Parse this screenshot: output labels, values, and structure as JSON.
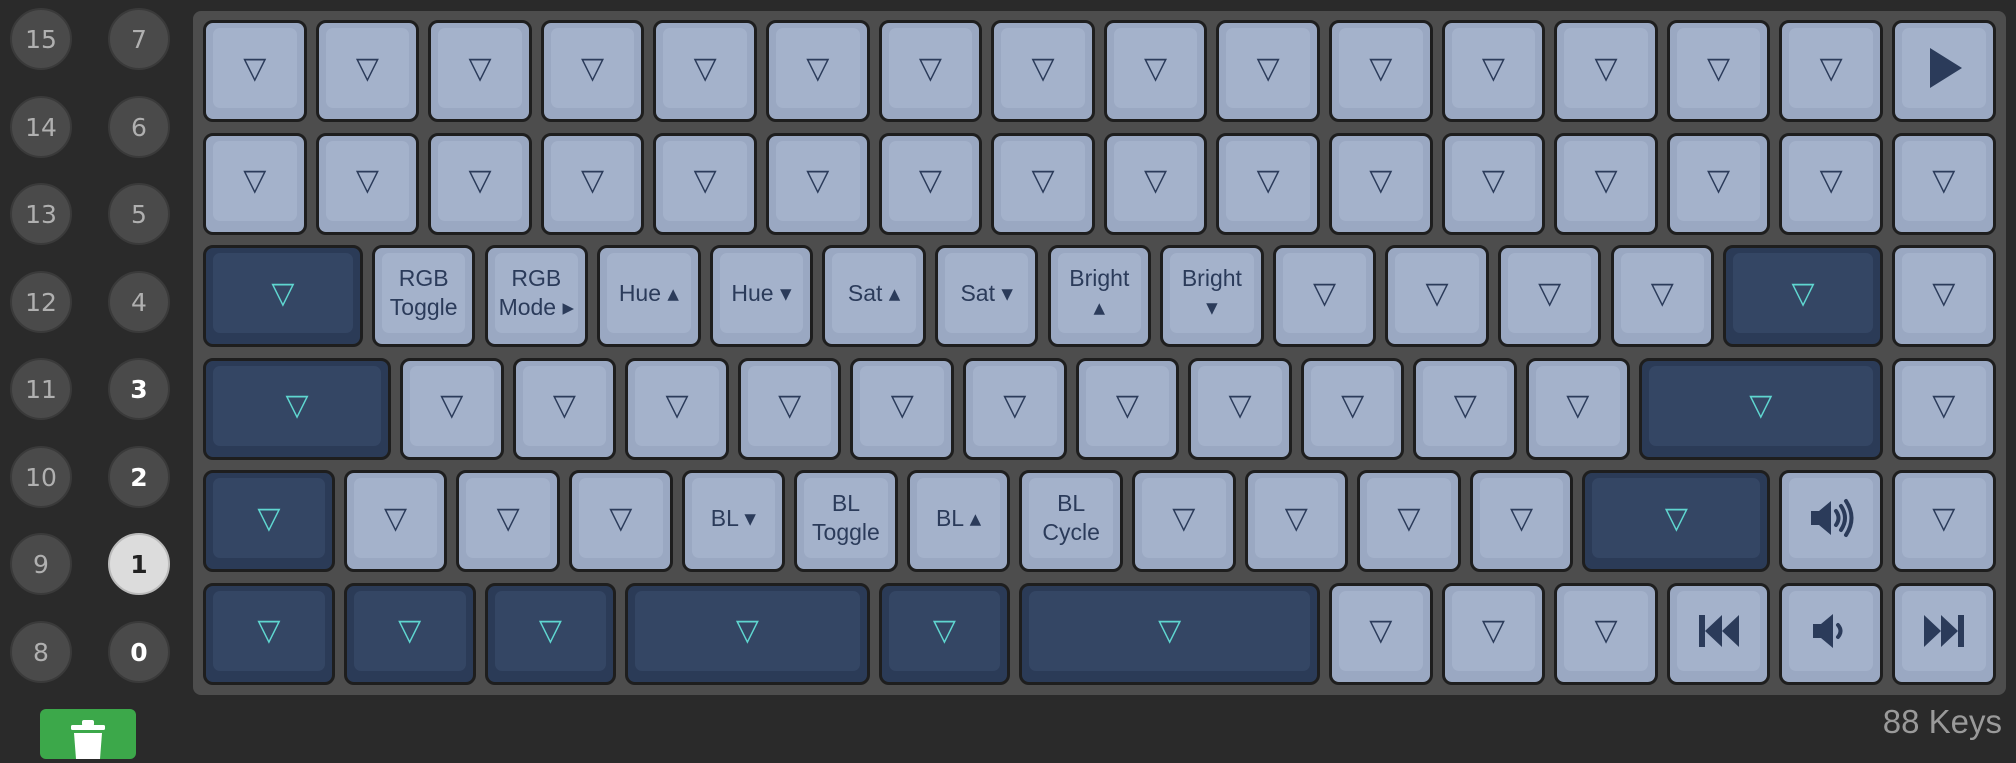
{
  "layers": {
    "left_column": [
      "15",
      "14",
      "13",
      "12",
      "11",
      "10",
      "9",
      "8"
    ],
    "right_column": [
      "7",
      "6",
      "5",
      "4",
      "3",
      "2",
      "1",
      "0"
    ],
    "used": [
      "3",
      "2",
      "1",
      "0"
    ],
    "active": "1"
  },
  "key_symbols": {
    "transparent": "▽",
    "play": "play-icon",
    "volume_up": "volume-up-icon",
    "volume_down": "volume-down-icon",
    "prev_track": "previous-track-icon",
    "next_track": "next-track-icon"
  },
  "keys": {
    "rgb_toggle": "RGB\nToggle",
    "rgb_mode": "RGB\nMode ▸",
    "hue_up": "Hue ▴",
    "hue_down": "Hue ▾",
    "sat_up": "Sat ▴",
    "sat_down": "Sat ▾",
    "bright_up": "Bright\n▴",
    "bright_down": "Bright\n▾",
    "bl_down": "BL ▾",
    "bl_toggle": "BL\nToggle",
    "bl_up": "BL ▴",
    "bl_cycle": "BL\nCycle"
  },
  "footer": {
    "key_count": "88 Keys",
    "delete_icon": "trash-icon"
  },
  "colors": {
    "key_light": "#a4b2cb",
    "key_dark": "#344664",
    "legend_dark": "#2b3b5a",
    "legend_mod": "#5fd6d0",
    "trash_green": "#3ca84a"
  }
}
